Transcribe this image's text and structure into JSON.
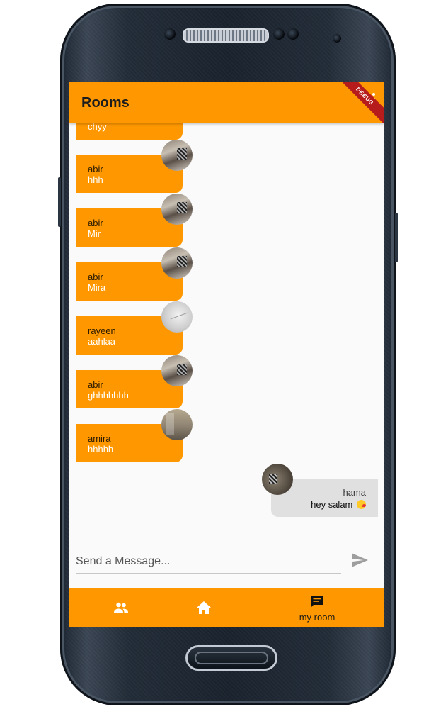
{
  "app": {
    "title": "Rooms",
    "debug_banner": "DEBUG"
  },
  "messages_left": [
    {
      "name": "",
      "text": "chyy",
      "avatar": "room-photo"
    },
    {
      "name": "abir",
      "text": "hhh",
      "avatar": "room-photo"
    },
    {
      "name": "abir",
      "text": "Mir",
      "avatar": "room-photo"
    },
    {
      "name": "abir",
      "text": "Mira",
      "avatar": "room-photo"
    },
    {
      "name": "rayeen",
      "text": "aahlaa",
      "avatar": "grey-photo"
    },
    {
      "name": "abir",
      "text": "ghhhhhhh",
      "avatar": "room-photo"
    },
    {
      "name": "amira",
      "text": "hhhhh",
      "avatar": "wall-photo"
    }
  ],
  "message_right": {
    "name": "hama",
    "text": "hey salam",
    "emoji": "kissing-face-emoji",
    "avatar": "dark-photo"
  },
  "composer": {
    "placeholder": "Send a Message...",
    "send_icon": "send-icon"
  },
  "bottom_nav": {
    "items": [
      {
        "icon": "people-icon",
        "label": ""
      },
      {
        "icon": "home-icon",
        "label": ""
      },
      {
        "icon": "chat-icon",
        "label": "my room"
      }
    ],
    "active_index": 2
  },
  "colors": {
    "accent": "#ff9800",
    "incoming_text": "#ffffff",
    "outgoing_bubble": "#e0e0e0"
  }
}
